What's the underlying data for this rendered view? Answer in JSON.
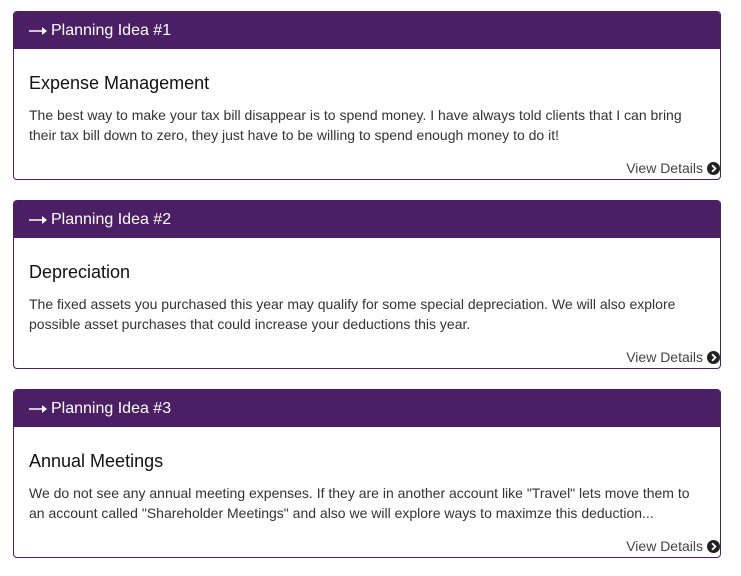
{
  "panels": [
    {
      "header": "Planning Idea #1",
      "title": "Expense Management",
      "description": "The best way to make your tax bill disappear is to spend money. I have always told clients that I can bring their tax bill down to zero, they just have to be willing to spend enough money to do it!",
      "link": "View Details"
    },
    {
      "header": "Planning Idea #2",
      "title": "Depreciation",
      "description": "The fixed assets you purchased this year may qualify for some special depreciation. We will also explore possible asset purchases that could increase your deductions this year.",
      "link": "View Details"
    },
    {
      "header": "Planning Idea #3",
      "title": "Annual Meetings",
      "description": "We do not see any annual meeting expenses. If they are in another account like \"Travel\" lets move them to an account called \"Shareholder Meetings\" and also we will explore ways to maximze this deduction...",
      "link": "View Details"
    }
  ],
  "icons": {
    "header": "long-arrow-right-icon",
    "link": "chevron-circle-right-icon"
  },
  "colors": {
    "header_bg": "#4a1f63",
    "header_text": "#ffffff",
    "border": "#4a1f63"
  }
}
